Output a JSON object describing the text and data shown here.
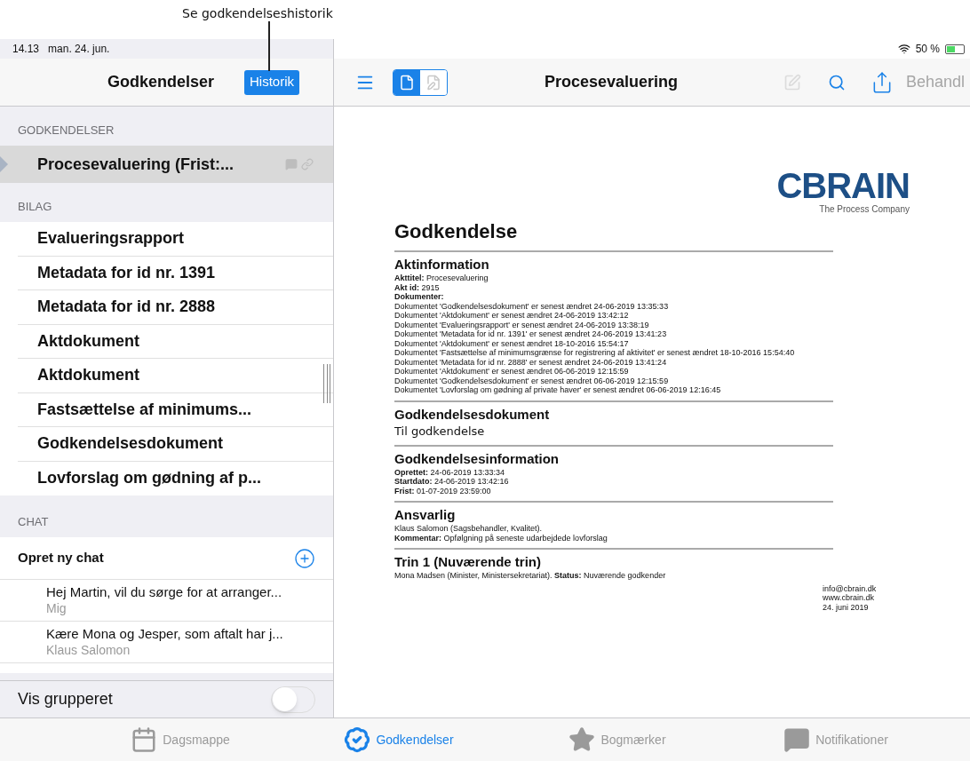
{
  "callout": {
    "text": "Se godkendelseshistorik"
  },
  "status_bar": {
    "time": "14.13",
    "date": "man. 24. jun.",
    "battery": "50 %"
  },
  "sidebar": {
    "title": "Godkendelser",
    "history_button": "Historik",
    "approvals_header": "GODKENDELSER",
    "approvals": [
      {
        "label": "Procesevaluering (Frist:...",
        "selected": true
      }
    ],
    "attachments_header": "BILAG",
    "attachments": [
      "Evalueringsrapport",
      "Metadata for id nr. 1391",
      "Metadata for id nr. 2888",
      "Aktdokument",
      "Aktdokument",
      "Fastsættelse af minimums...",
      "Godkendelsesdokument",
      "Lovforslag om gødning af p..."
    ],
    "chat_header": "CHAT",
    "new_chat": "Opret ny chat",
    "chats": [
      {
        "message": "Hej Martin, vil du sørge for at arranger...",
        "author": "Mig"
      },
      {
        "message": "Kære Mona og Jesper, som aftalt har j...",
        "author": "Klaus Salomon"
      }
    ],
    "group_toggle": {
      "label": "Vis grupperet",
      "on": false
    }
  },
  "document_toolbar": {
    "title": "Procesevaluering",
    "view_toggle": [
      {
        "kind": "document",
        "selected": true
      },
      {
        "kind": "annotate",
        "selected": false
      }
    ],
    "action": {
      "label": "Behandl",
      "disabled": true
    }
  },
  "document": {
    "logo": {
      "name": "CBRAIN",
      "tagline": "The Process Company"
    },
    "heading": "Godkendelse",
    "sections": [
      {
        "heading": "Aktinformation",
        "kind": "small",
        "lines": [
          "**Akttitel:** Procesevaluering",
          "**Akt id:** 2915",
          "**Dokumenter:**",
          "Dokumentet 'Godkendelsesdokument' er senest ændret 24-06-2019 13:35:33",
          "Dokumentet 'Aktdokument' er senest ændret 24-06-2019 13:42:12",
          "Dokumentet 'Evalueringsrapport' er senest ændret 24-06-2019 13:38:19",
          "Dokumentet 'Metadata for id nr. 1391' er senest ændret 24-06-2019 13:41:23",
          "Dokumentet 'Aktdokument' er senest ændret 18-10-2016 15:54:17",
          "Dokumentet 'Fastsættelse af minimumsgrænse for registrering af aktivitet' er senest ændret 18-10-2016 15:54:40",
          "Dokumentet 'Metadata for id nr. 2888' er senest ændret 24-06-2019 13:41:24",
          "Dokumentet 'Aktdokument' er senest ændret 06-06-2019 12:15:59",
          "Dokumentet 'Godkendelsesdokument' er senest ændret 06-06-2019 12:15:59",
          "Dokumentet 'Lovforslag om gødning af private haver' er senest ændret 06-06-2019 12:16:45"
        ]
      },
      {
        "heading": "Godkendelsesdokument",
        "kind": "large",
        "lines": [
          "Til godkendelse"
        ]
      },
      {
        "heading": "Godkendelsesinformation",
        "kind": "small",
        "lines": [
          "**Oprettet:** 24-06-2019 13:33:34",
          "**Startdato:** 24-06-2019 13:42:16",
          "**Frist:** 01-07-2019 23:59:00"
        ]
      },
      {
        "heading": "Ansvarlig",
        "kind": "small",
        "lines": [
          "Klaus Salomon (Sagsbehandler, Kvalitet).",
          "**Kommentar:** Opfølgning på seneste udarbejdede lovforslag"
        ]
      },
      {
        "heading": "Trin 1 (Nuværende trin)",
        "kind": "small",
        "lines": [
          "Mona Madsen (Minister, Ministersekretariat). **Status:** Nuværende godkender"
        ]
      }
    ],
    "contact": [
      "info@cbrain.dk",
      "www.cbrain.dk",
      "24. juni 2019"
    ]
  },
  "tab_bar": [
    {
      "label": "Dagsmappe",
      "kind": "calendar",
      "selected": false
    },
    {
      "label": "Godkendelser",
      "kind": "approval",
      "selected": true
    },
    {
      "label": "Bogmærker",
      "kind": "star",
      "selected": false
    },
    {
      "label": "Notifikationer",
      "kind": "message",
      "selected": false
    }
  ]
}
